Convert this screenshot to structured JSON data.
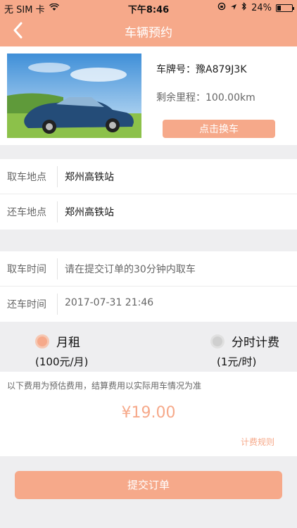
{
  "status_bar": {
    "carrier": "无 SIM 卡",
    "time": "下午8:46",
    "battery": "24%",
    "battery_level": 0.24
  },
  "nav": {
    "title": "车辆预约",
    "back_icon": "chevron-left-icon"
  },
  "car": {
    "plate": "车牌号：豫A879J3K",
    "mileage": "剩余里程：100.00km",
    "change_button": "点击换车"
  },
  "locations": [
    {
      "label": "取车地点",
      "value": "郑州高铁站"
    },
    {
      "label": "还车地点",
      "value": "郑州高铁站"
    }
  ],
  "times": [
    {
      "label": "取车时间",
      "value": "请在提交订单的30分钟内取车"
    },
    {
      "label": "还车时间",
      "value": "2017-07-31 21:46"
    }
  ],
  "billing": {
    "options": [
      {
        "name": "月租",
        "rate": "(100元/月)",
        "selected": true
      },
      {
        "name": "分时计费",
        "rate": "(1元/时)",
        "selected": false
      }
    ]
  },
  "price": {
    "note": "以下费用为预估费用，结算费用以实际用车情况为准",
    "amount": "¥19.00",
    "rules_link": "计费规则"
  },
  "submit_label": "提交订单",
  "colors": {
    "accent": "#f6a98a",
    "background": "#eeeef0"
  }
}
